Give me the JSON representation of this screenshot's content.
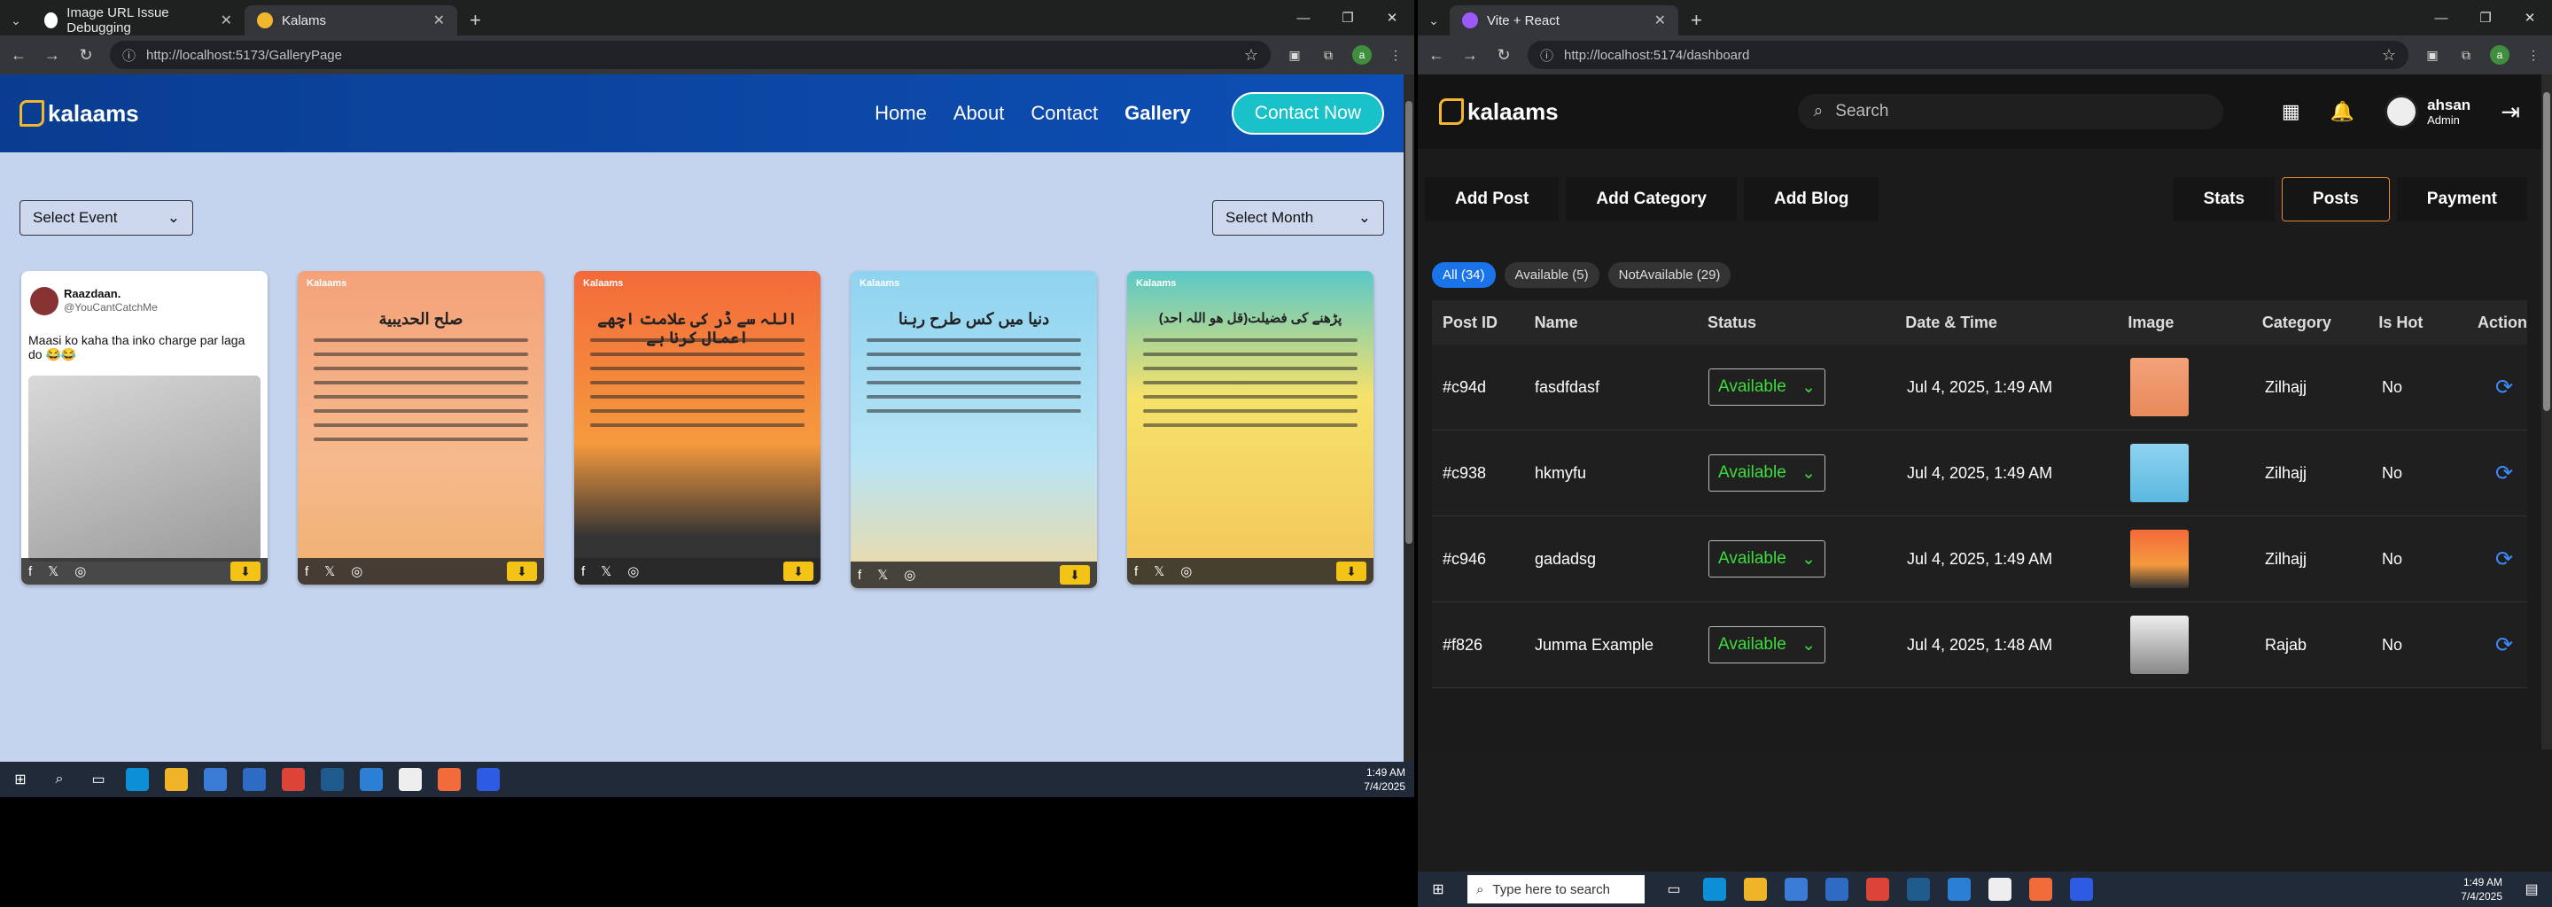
{
  "left": {
    "tabs": [
      {
        "title": "Image URL Issue Debugging",
        "active": false
      },
      {
        "title": "Kalams",
        "active": true
      }
    ],
    "url": "http://localhost:5173/GalleryPage",
    "site": {
      "logo": "kalaams",
      "nav": [
        "Home",
        "About",
        "Contact",
        "Gallery"
      ],
      "cta": "Contact Now"
    },
    "filters": {
      "event": "Select Event",
      "month": "Select Month"
    },
    "cards": [
      {
        "type": "tweet",
        "name": "Raazdaan.",
        "handle": "@YouCantCatchMe",
        "text": "Maasi ko kaha tha inko charge par laga do 😂😂"
      },
      {
        "type": "art",
        "title": "صلح الحديبية",
        "brand": "Kalaams"
      },
      {
        "type": "art",
        "title": "اللہ سے ڈر کی علامت اچھے اعمال کرنا ہے",
        "brand": "Kalaams"
      },
      {
        "type": "art",
        "title": "دنیا میں کس طرح رہنا",
        "brand": "Kalaams"
      },
      {
        "type": "art",
        "title": "(قل ھو اللہ احد)پڑھنے کی فضیلت",
        "brand": "Kalaams"
      }
    ],
    "taskbar_time": "1:49 AM",
    "taskbar_date": "7/4/2025"
  },
  "right": {
    "tabs": [
      {
        "title": "Vite + React",
        "active": true
      }
    ],
    "url": "http://localhost:5174/dashboard",
    "logo": "kalaams",
    "search_placeholder": "Search",
    "user": {
      "name": "ahsan",
      "role": "Admin"
    },
    "actions": [
      "Add Post",
      "Add Category",
      "Add Blog"
    ],
    "views": [
      "Stats",
      "Posts",
      "Payment"
    ],
    "active_view": "Posts",
    "filters": [
      "All (34)",
      "Available (5)",
      "NotAvailable (29)"
    ],
    "columns": [
      "Post ID",
      "Name",
      "Status",
      "Date & Time",
      "Image",
      "Category",
      "Is Hot",
      "Action"
    ],
    "rows": [
      {
        "id": "#c94d",
        "name": "fasdfdasf",
        "status": "Available",
        "date": "Jul 4, 2025, 1:49 AM",
        "category": "Zilhajj",
        "hot": "No"
      },
      {
        "id": "#c938",
        "name": "hkmyfu",
        "status": "Available",
        "date": "Jul 4, 2025, 1:49 AM",
        "category": "Zilhajj",
        "hot": "No"
      },
      {
        "id": "#c946",
        "name": "gadadsg",
        "status": "Available",
        "date": "Jul 4, 2025, 1:49 AM",
        "category": "Zilhajj",
        "hot": "No"
      },
      {
        "id": "#f826",
        "name": "Jumma Example",
        "status": "Available",
        "date": "Jul 4, 2025, 1:48 AM",
        "category": "Rajab",
        "hot": "No"
      }
    ],
    "taskbar_search": "Type here to search",
    "taskbar_time": "1:49 AM",
    "taskbar_date": "7/4/2025"
  }
}
